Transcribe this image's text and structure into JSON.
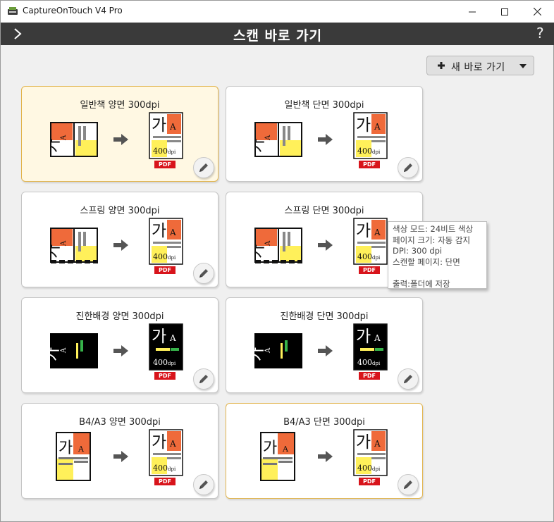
{
  "window": {
    "title": "CaptureOnTouch V4 Pro"
  },
  "header": {
    "title": "스캔 바로 가기",
    "help": "?"
  },
  "new_button": {
    "label": "새 바로 가기"
  },
  "preview": {
    "source_char": "가",
    "source_char_small": "A",
    "dest_dpi": "400",
    "dest_dpi_unit": "dpi",
    "pdf_badge": "PDF"
  },
  "shortcuts": [
    {
      "title": "일반책 양면 300dpi"
    },
    {
      "title": "일반책 단면 300dpi"
    },
    {
      "title": "스프링 양면 300dpi"
    },
    {
      "title": "스프링 단면 300dpi"
    },
    {
      "title": "진한배경 양면 300dpi"
    },
    {
      "title": "진한배경 단면 300dpi"
    },
    {
      "title": "B4/A3 양면 300dpi"
    },
    {
      "title": "B4/A3 단면 300dpi"
    }
  ],
  "tooltip": {
    "lines": [
      "색상 모드: 24비트 색상",
      "페이지 크기: 자동 감지",
      "DPI: 300 dpi",
      "스캔할 페이지: 단면",
      "",
      "출력:폴더에 저장"
    ]
  },
  "colors": {
    "accent": "#ef6a3a",
    "highlight": "#fff05a",
    "pdf_red": "#d8141b",
    "selected_border": "#e2b44c",
    "header_bg": "#3a3a3a"
  }
}
